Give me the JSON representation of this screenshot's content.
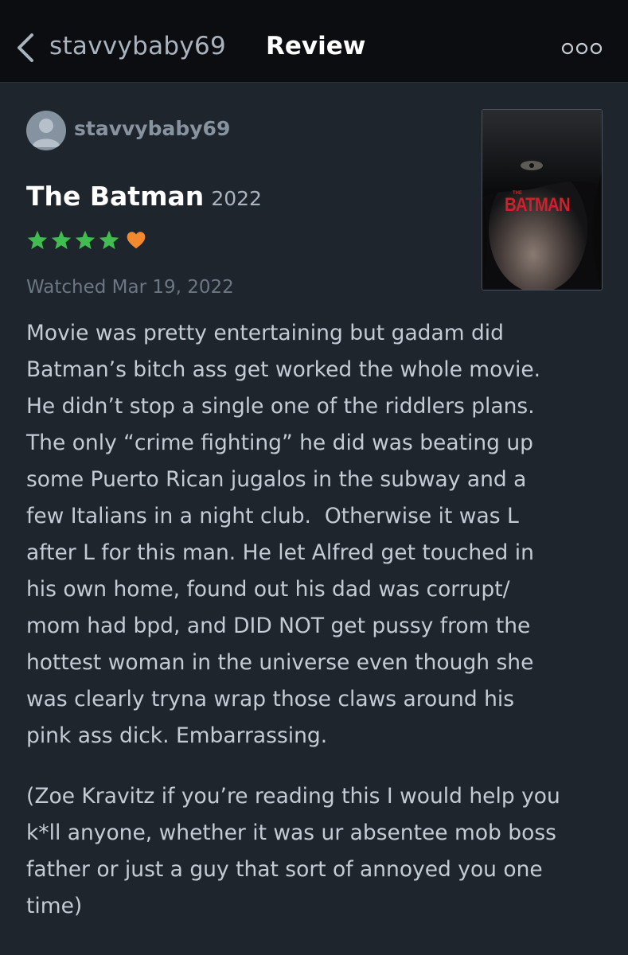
{
  "nav": {
    "username": "stavvybaby69",
    "title": "Review",
    "back_icon": "chevron-left-icon",
    "more_icon": "more-dots-icon"
  },
  "review": {
    "author": "stavvybaby69",
    "film_title": "The Batman",
    "film_year": "2022",
    "stars": 4,
    "liked": true,
    "star_color": "#40bc50",
    "heart_color": "#f2892f",
    "watched": "Watched Mar 19, 2022",
    "poster_text": "BATMAN",
    "poster_small": "THE",
    "paragraph1": [
      "Movie was pretty entertaining but gadam did",
      "Batman’s bitch ass get worked the whole movie.",
      "He didn’t stop a single one of the riddlers plans.",
      "The only “crime fighting” he did was beating up",
      "some Puerto Rican jugalos in the subway and a",
      "few Italians in a night club.  Otherwise it was L",
      "after L for this man. He let Alfred get touched in",
      "his own home, found out his dad was corrupt/",
      "mom had bpd, and DID NOT get pussy from the",
      "hottest woman in the universe even though she",
      "was clearly tryna wrap those claws around his",
      "pink ass dick. Embarrassing."
    ],
    "paragraph2": [
      "(Zoe Kravitz if you’re reading this I would help you",
      "k*ll anyone, whether it was ur absentee mob boss",
      "father or just a guy that sort of annoyed you one",
      "time)"
    ]
  }
}
